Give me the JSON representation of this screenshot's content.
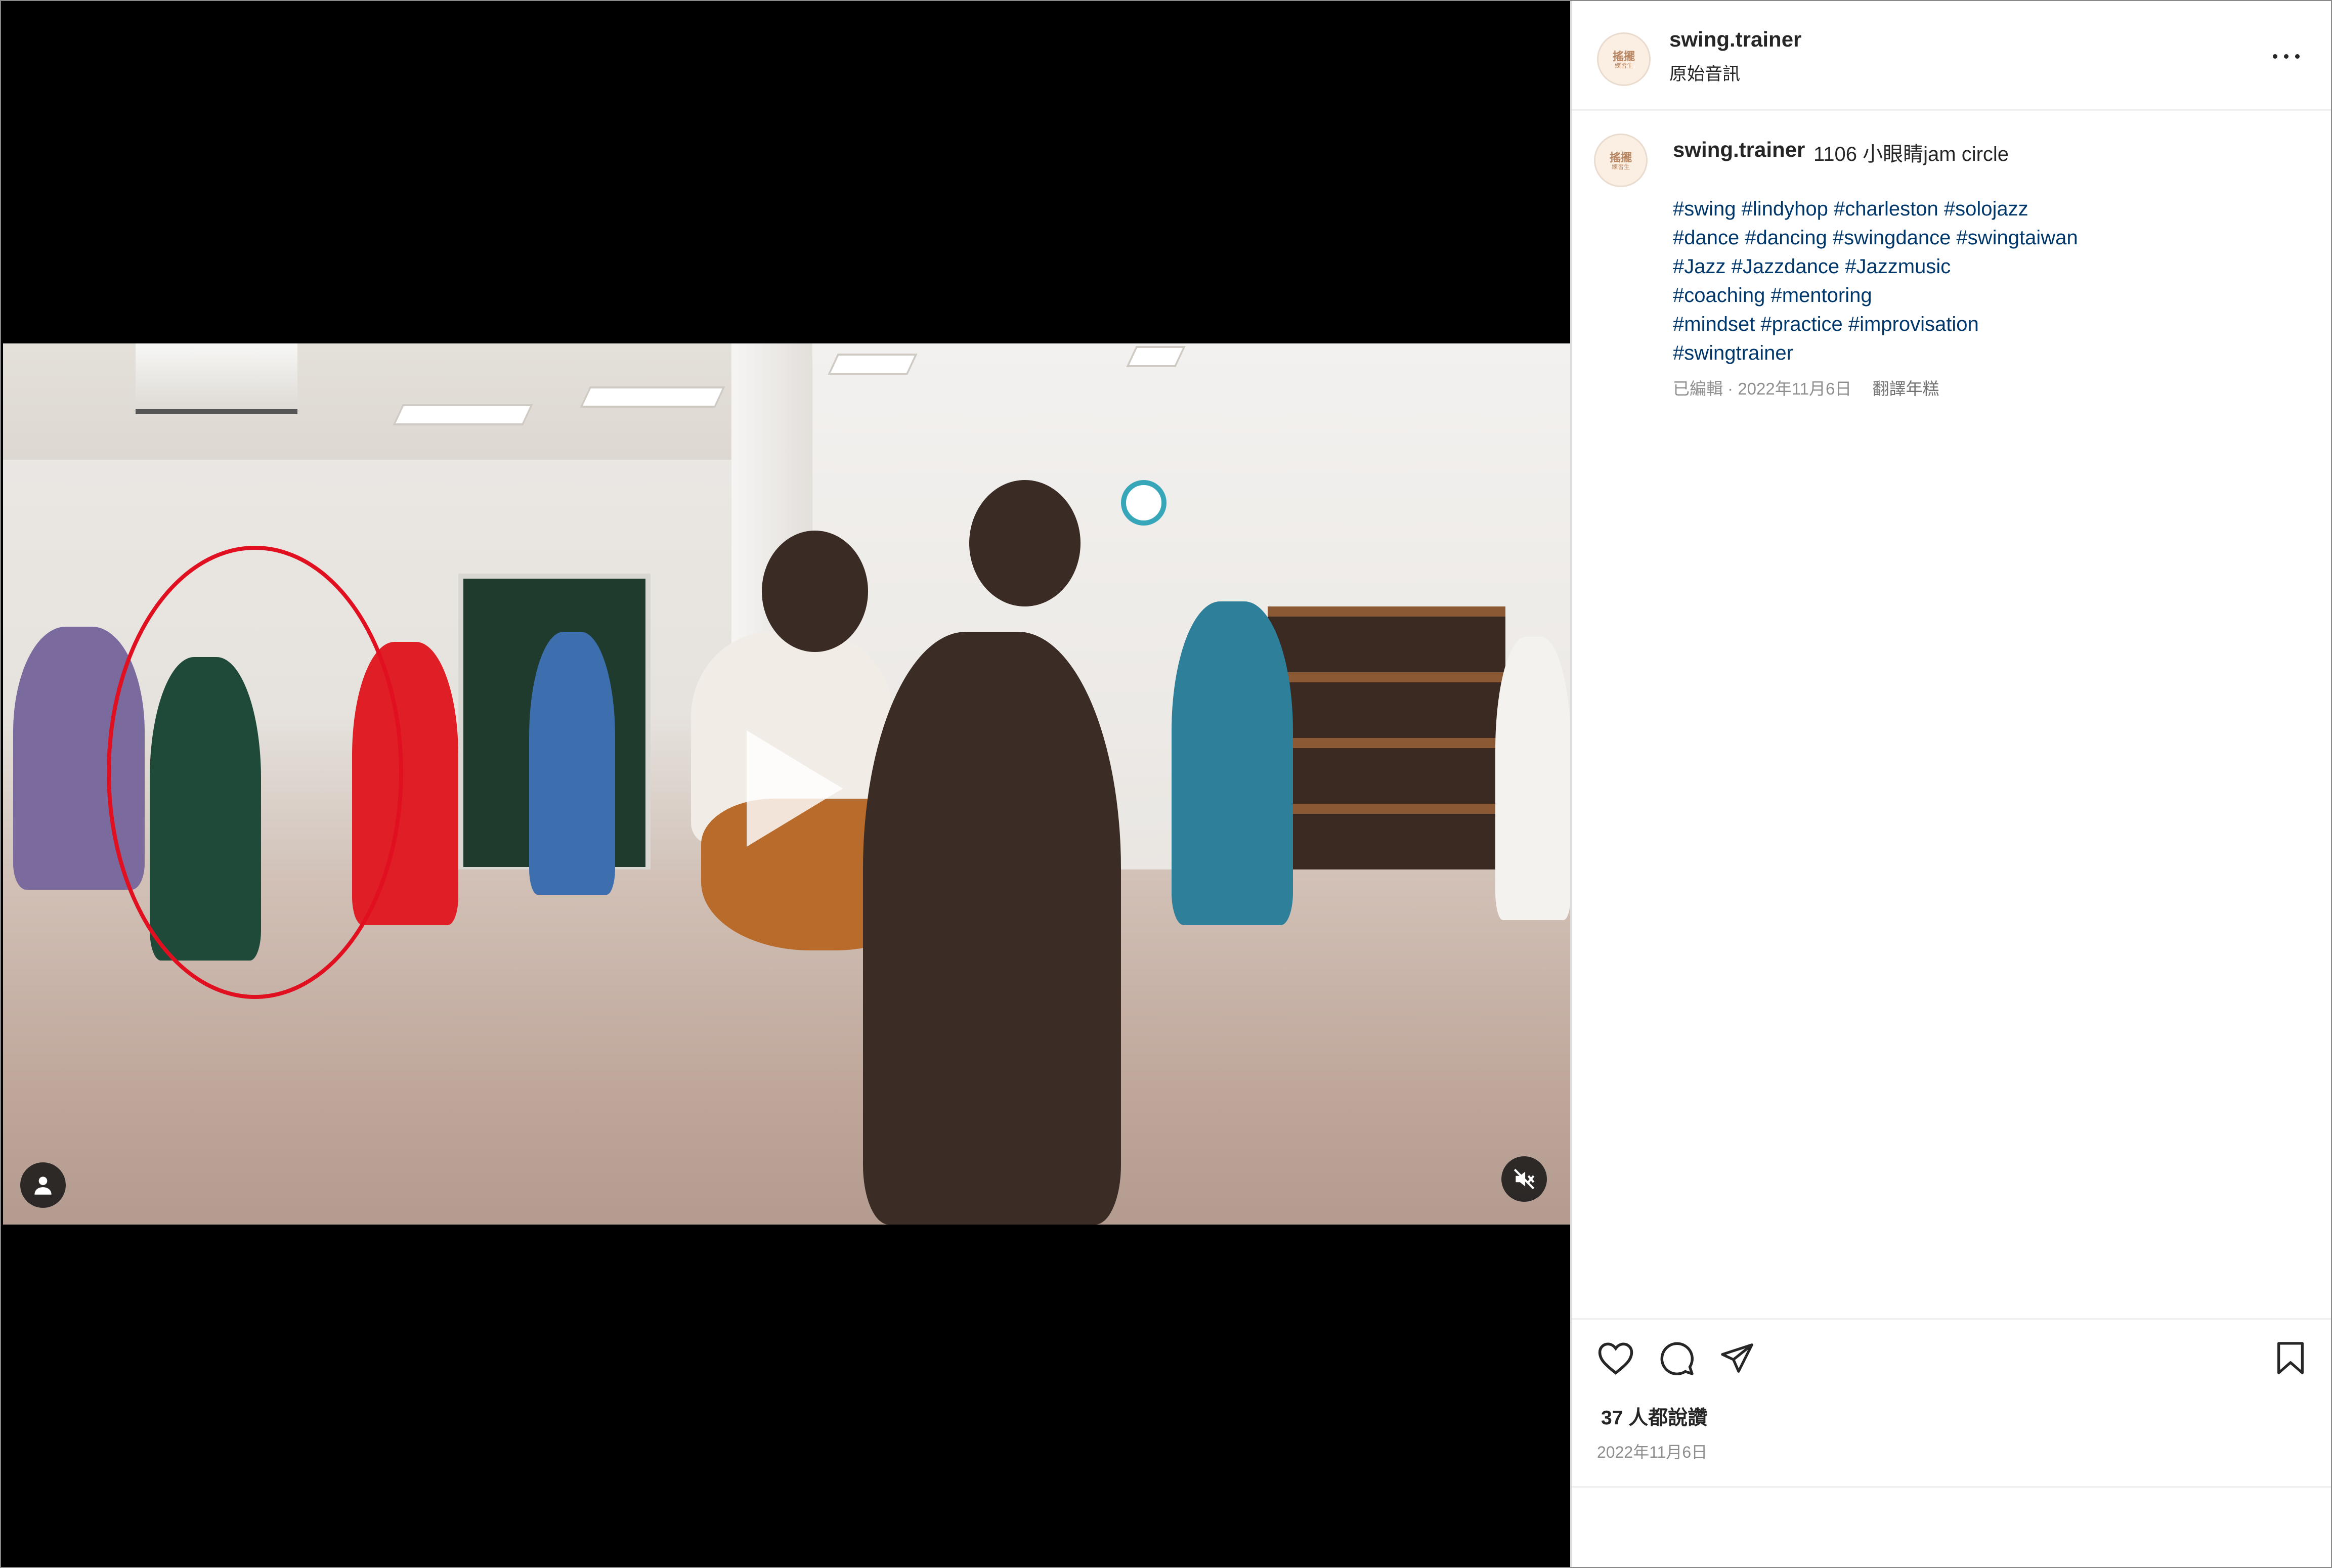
{
  "post": {
    "username": "swing.trainer",
    "audio_label": "原始音訊",
    "avatar_text_top": "搖擺",
    "avatar_text_bottom": "練習生"
  },
  "caption": {
    "username": "swing.trainer",
    "text": "1106 小眼睛jam circle",
    "hashtag_lines": [
      "#swing #lindyhop #charleston #solojazz",
      "#dance #dancing #swingdance #swingtaiwan",
      "#Jazz #Jazzdance #Jazzmusic",
      "#coaching #mentoring",
      "#mindset #practice #improvisation",
      "#swingtrainer"
    ],
    "edited_meta": "已編輯 · 2022年11月6日",
    "translate_label": "翻譯年糕"
  },
  "engagement": {
    "likes_text": "37 人都說讚",
    "date": "2022年11月6日"
  },
  "media": {
    "state": "paused",
    "muted": true,
    "annotation": "red circle around a dancer on the left"
  },
  "icons": {
    "like": "heart-icon",
    "comment": "comment-icon",
    "share": "paper-plane-icon",
    "save": "bookmark-icon",
    "more": "ellipsis-icon",
    "tagged_users": "user-icon",
    "mute": "speaker-muted-icon",
    "play": "play-icon"
  },
  "colors": {
    "link": "#00376b",
    "annotation_circle": "#e01020",
    "secondary_text": "#8e8e8e"
  }
}
